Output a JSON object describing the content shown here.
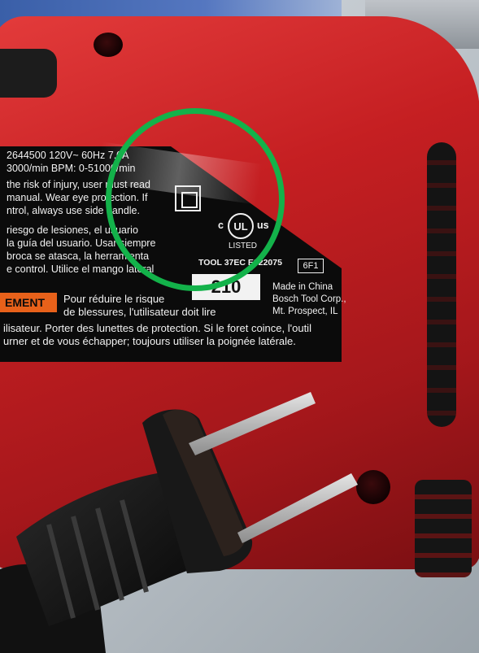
{
  "photo": {
    "label_lines": [
      "2644500  120V~  60Hz  7.0A",
      "3000/min BPM: 0-51000/min",
      "the risk of injury, user must read",
      "manual. Wear eye protection. If",
      "ntrol, always use side handle.",
      "riesgo de lesiones, el usuario",
      "la guía del usuario. Usar siempre",
      "broca se atasca, la herramienta",
      "e control. Utilice el mango lateral",
      "Pour réduire le risque",
      "de blessures, l'utilisateur doit lire",
      "ilisateur. Porter des lunettes de protection. Si le foret coince, l'outil",
      "urner et de vous échapper; toujours utiliser la poignée latérale."
    ],
    "warning_badge": "EMENT",
    "ul_text": "UL",
    "ul_c": "c",
    "ul_us": "us",
    "listed": "LISTED",
    "tool_code": "TOOL 37EC  E322075",
    "model_box": "210",
    "code_box": "6F1",
    "made_in": [
      "Made in China",
      "Bosch Tool Corp.,",
      "Mt. Prospect, IL"
    ]
  },
  "colors": {
    "drill_red": "#c51f22",
    "label_black": "#0b0b0b",
    "warning_orange": "#e8611a",
    "highlight_green": "#13b24a"
  }
}
